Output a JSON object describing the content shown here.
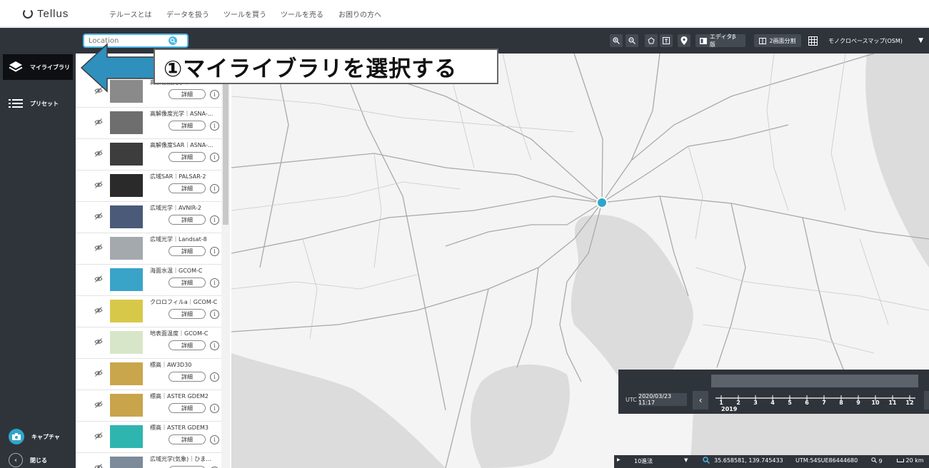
{
  "header": {
    "logo": "Tellus",
    "nav": [
      "テルースとは",
      "データを扱う",
      "ツールを買う",
      "ツールを売る",
      "お困りの方へ"
    ]
  },
  "sidebar": {
    "items": [
      {
        "label": "マイライブラリ",
        "icon": "layers-icon",
        "active": true
      },
      {
        "label": "プリセット",
        "icon": "list-icon",
        "active": false
      }
    ],
    "bottom": [
      {
        "label": "キャプチャ",
        "icon": "camera-icon"
      },
      {
        "label": "閉じる",
        "icon": "chevron-left-icon"
      }
    ]
  },
  "toolbar": {
    "search_placeholder": "Location",
    "editor_label": "エディタβ版",
    "split_label": "2画面分割",
    "basemap_label": "モノクロベースマップ(OSM)"
  },
  "callout": {
    "text": "①マイライブラリを選択する"
  },
  "layers": [
    {
      "name": "高解像度光学｜SLATS",
      "thumb": "#8a8a8a"
    },
    {
      "name": "高解像度光学｜ASNA-...",
      "thumb": "#6e6e6e"
    },
    {
      "name": "高解像度SAR｜ASNA-...",
      "thumb": "#3d3d3d"
    },
    {
      "name": "広域SAR｜PALSAR-2",
      "thumb": "#2a2a2a"
    },
    {
      "name": "広域光学｜AVNIR-2",
      "thumb": "#4a5a78"
    },
    {
      "name": "広域光学｜Landsat-8",
      "thumb": "#a4a9ad"
    },
    {
      "name": "海面水温｜GCOM-C",
      "thumb": "#3aa3c8"
    },
    {
      "name": "クロロフィルa｜GCOM-C",
      "thumb": "#d8c84a"
    },
    {
      "name": "地表面温度｜GCOM-C",
      "thumb": "#d7e6c8"
    },
    {
      "name": "標高｜AW3D30",
      "thumb": "#c9a64c"
    },
    {
      "name": "標高｜ASTER GDEM2",
      "thumb": "#c8a44a"
    },
    {
      "name": "標高｜ASTER GDEM3",
      "thumb": "#2fb5b0"
    },
    {
      "name": "広域光学(気象)｜ひま...",
      "thumb": "#7d8a99"
    }
  ],
  "detail_label": "詳細",
  "info_label": "i",
  "timeline": {
    "utc_label": "UTC",
    "datetime": "2020/03/23 11:17",
    "year": "2019",
    "months": [
      "1",
      "2",
      "3",
      "4",
      "5",
      "6",
      "7",
      "8",
      "9",
      "10",
      "11",
      "12"
    ]
  },
  "statusbar": {
    "method": "10進法",
    "coords": "35.658581, 139.745433",
    "utm": "UTM:54SUE86444680",
    "zoom": "9",
    "scale": "20 km"
  },
  "colors": {
    "accent": "#2fa6c9",
    "sidebar_bg": "#2f343b"
  }
}
